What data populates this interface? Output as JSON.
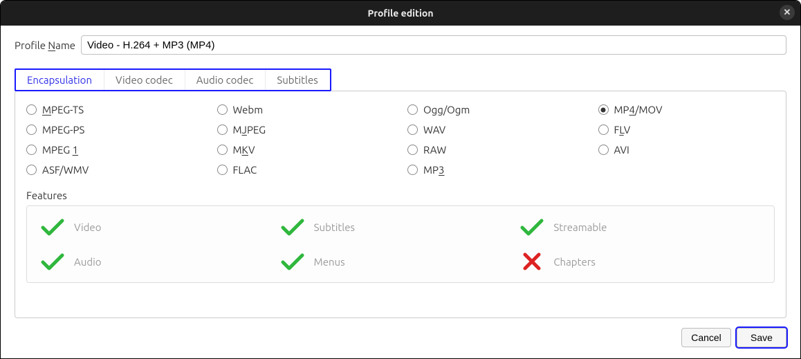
{
  "window": {
    "title": "Profile edition",
    "close_label": "✕"
  },
  "profile": {
    "label_pre": "Profile ",
    "label_u": "N",
    "label_post": "ame",
    "value": "Video - H.264 + MP3 (MP4)"
  },
  "tabs": {
    "encapsulation": "Encapsulation",
    "video_codec": "Video codec",
    "audio_codec": "Audio codec",
    "subtitles": "Subtitles",
    "active": "encapsulation"
  },
  "encapsulation_options": [
    {
      "id": "mpeg-ts",
      "pre": "",
      "u": "M",
      "post": "PEG-TS",
      "checked": false
    },
    {
      "id": "webm",
      "pre": "Webm",
      "u": "",
      "post": "",
      "checked": false
    },
    {
      "id": "ogg",
      "pre": "Ogg/Ogm",
      "u": "",
      "post": "",
      "checked": false
    },
    {
      "id": "mp4",
      "pre": "MP",
      "u": "4",
      "post": "/MOV",
      "checked": true
    },
    {
      "id": "mpeg-ps",
      "pre": "MPEG-PS",
      "u": "",
      "post": "",
      "checked": false
    },
    {
      "id": "mjpeg",
      "pre": "M",
      "u": "J",
      "post": "PEG",
      "checked": false
    },
    {
      "id": "wav",
      "pre": "WAV",
      "u": "",
      "post": "",
      "checked": false
    },
    {
      "id": "flv",
      "pre": "F",
      "u": "L",
      "post": "V",
      "checked": false
    },
    {
      "id": "mpeg1",
      "pre": "MPEG ",
      "u": "1",
      "post": "",
      "checked": false
    },
    {
      "id": "mkv",
      "pre": "M",
      "u": "K",
      "post": "V",
      "checked": false
    },
    {
      "id": "raw",
      "pre": "RAW",
      "u": "",
      "post": "",
      "checked": false
    },
    {
      "id": "avi",
      "pre": "AVI",
      "u": "",
      "post": "",
      "checked": false
    },
    {
      "id": "asf",
      "pre": "ASF/WMV",
      "u": "",
      "post": "",
      "checked": false
    },
    {
      "id": "flac",
      "pre": "FLAC",
      "u": "",
      "post": "",
      "checked": false
    },
    {
      "id": "mp3",
      "pre": "MP",
      "u": "3",
      "post": "",
      "checked": false
    }
  ],
  "features": {
    "label": "Features",
    "items": [
      {
        "name": "Video",
        "supported": true
      },
      {
        "name": "Subtitles",
        "supported": true
      },
      {
        "name": "Streamable",
        "supported": true
      },
      {
        "name": "Audio",
        "supported": true
      },
      {
        "name": "Menus",
        "supported": true
      },
      {
        "name": "Chapters",
        "supported": false
      }
    ]
  },
  "buttons": {
    "cancel": "Cancel",
    "save": "Save"
  }
}
